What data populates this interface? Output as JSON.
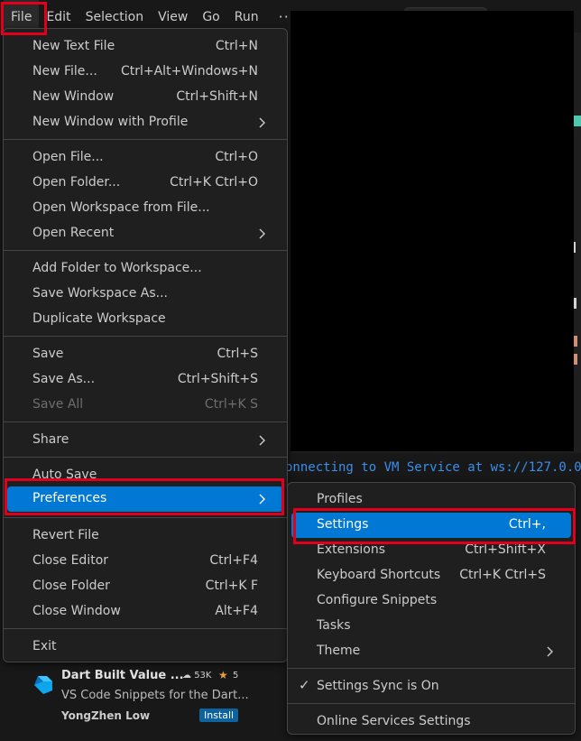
{
  "menubar": {
    "items": [
      "File",
      "Edit",
      "Selection",
      "View",
      "Go",
      "Run"
    ],
    "more": "···"
  },
  "terminal": {
    "text": "onnecting to VM Service at ws://127.0.0."
  },
  "file_menu": {
    "items": [
      {
        "label": "New Text File",
        "shortcut": "Ctrl+N"
      },
      {
        "label": "New File...",
        "shortcut": "Ctrl+Alt+Windows+N"
      },
      {
        "label": "New Window",
        "shortcut": "Ctrl+Shift+N"
      },
      {
        "label": "New Window with Profile",
        "shortcut": ""
      },
      {
        "label": "Open File...",
        "shortcut": "Ctrl+O"
      },
      {
        "label": "Open Folder...",
        "shortcut": "Ctrl+K Ctrl+O"
      },
      {
        "label": "Open Workspace from File...",
        "shortcut": ""
      },
      {
        "label": "Open Recent",
        "shortcut": ""
      },
      {
        "label": "Add Folder to Workspace...",
        "shortcut": ""
      },
      {
        "label": "Save Workspace As...",
        "shortcut": ""
      },
      {
        "label": "Duplicate Workspace",
        "shortcut": ""
      },
      {
        "label": "Save",
        "shortcut": "Ctrl+S"
      },
      {
        "label": "Save As...",
        "shortcut": "Ctrl+Shift+S"
      },
      {
        "label": "Save All",
        "shortcut": "Ctrl+K S"
      },
      {
        "label": "Share",
        "shortcut": ""
      },
      {
        "label": "Auto Save",
        "shortcut": ""
      },
      {
        "label": "Preferences",
        "shortcut": ""
      },
      {
        "label": "Revert File",
        "shortcut": ""
      },
      {
        "label": "Close Editor",
        "shortcut": "Ctrl+F4"
      },
      {
        "label": "Close Folder",
        "shortcut": "Ctrl+K F"
      },
      {
        "label": "Close Window",
        "shortcut": "Alt+F4"
      },
      {
        "label": "Exit",
        "shortcut": ""
      }
    ]
  },
  "preferences_menu": {
    "items": [
      {
        "label": "Profiles",
        "shortcut": ""
      },
      {
        "label": "Settings",
        "shortcut": "Ctrl+,"
      },
      {
        "label": "Extensions",
        "shortcut": "Ctrl+Shift+X"
      },
      {
        "label": "Keyboard Shortcuts",
        "shortcut": "Ctrl+K Ctrl+S"
      },
      {
        "label": "Configure Snippets",
        "shortcut": ""
      },
      {
        "label": "Tasks",
        "shortcut": ""
      },
      {
        "label": "Theme",
        "shortcut": ""
      },
      {
        "label": "Settings Sync is On",
        "shortcut": ""
      },
      {
        "label": "Online Services Settings",
        "shortcut": ""
      }
    ],
    "check_glyph": "✓"
  },
  "extension_card": {
    "name": "Dart Built Value ...",
    "downloads": "53K",
    "rating": "5",
    "description": "VS Code Snippets for the Dart...",
    "author": "YongZhen Low",
    "install_label": "Install"
  },
  "colors": {
    "menu_bg": "#1f1f1f",
    "active_item": "#0078d4",
    "annotation_red": "#e0001b",
    "terminal_text": "#3b8eea"
  }
}
